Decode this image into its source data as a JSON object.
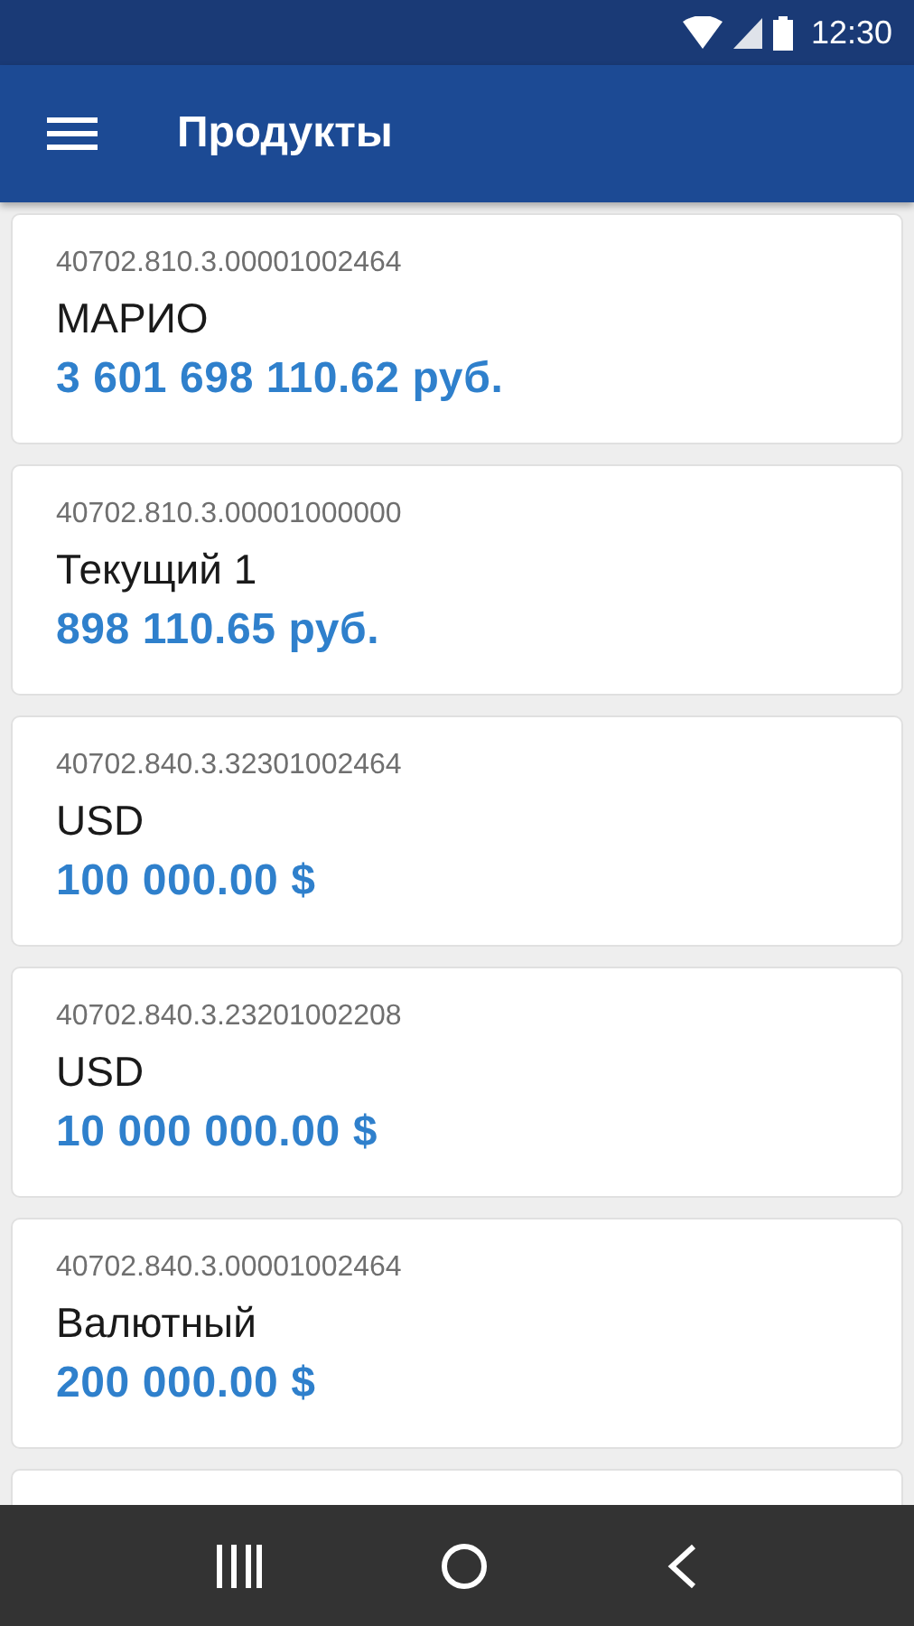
{
  "status_bar": {
    "time": "12:30"
  },
  "app_bar": {
    "title": "Продукты"
  },
  "accounts": [
    {
      "number": "40702.810.3.00001002464",
      "name": "МАРИО",
      "balance": "3 601 698 110.62 руб."
    },
    {
      "number": "40702.810.3.00001000000",
      "name": "Текущий 1",
      "balance": "898 110.65 руб."
    },
    {
      "number": "40702.840.3.32301002464",
      "name": "USD",
      "balance": "100 000.00 $"
    },
    {
      "number": "40702.840.3.23201002208",
      "name": "USD",
      "balance": "10 000 000.00 $"
    },
    {
      "number": "40702.840.3.00001002464",
      "name": "Валютный",
      "balance": "200 000.00 $"
    }
  ]
}
